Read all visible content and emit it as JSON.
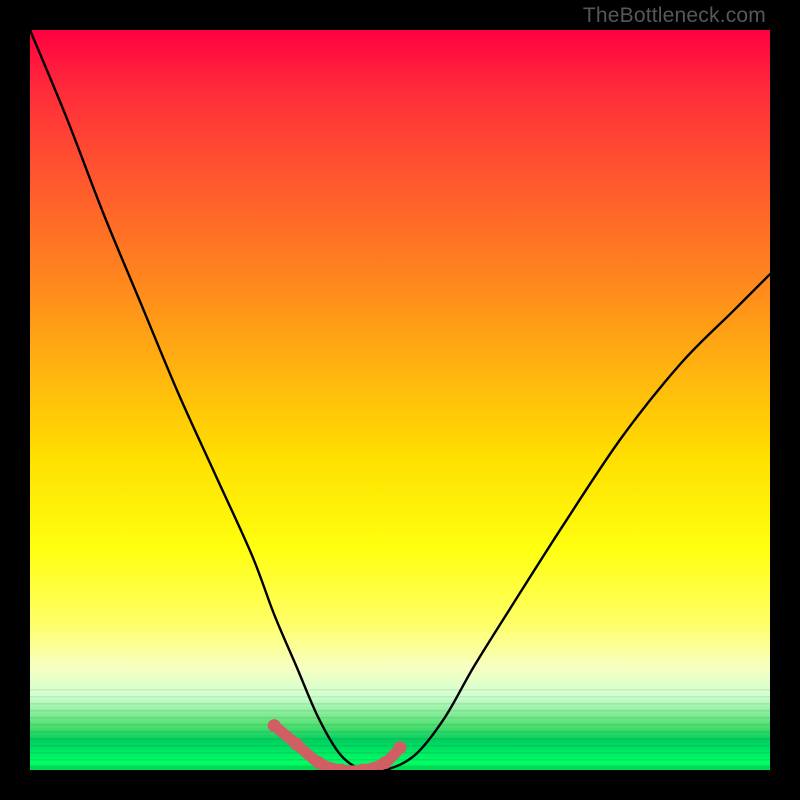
{
  "watermark": "TheBottleneck.com",
  "chart_data": {
    "type": "line",
    "title": "",
    "xlabel": "",
    "ylabel": "",
    "xlim": [
      0,
      100
    ],
    "ylim": [
      0,
      100
    ],
    "grid": false,
    "series": [
      {
        "name": "bottleneck-curve",
        "x": [
          0,
          5,
          10,
          15,
          20,
          25,
          30,
          33,
          36,
          39,
          42,
          45,
          48,
          52,
          56,
          60,
          65,
          72,
          80,
          88,
          95,
          100
        ],
        "values": [
          100,
          88,
          75,
          63,
          51,
          40,
          29,
          21,
          14,
          7,
          2,
          0,
          0,
          2,
          7,
          14,
          22,
          33,
          45,
          55,
          62,
          67
        ]
      }
    ],
    "highlight": {
      "name": "optimal-band",
      "color": "#cf5f62",
      "x": [
        33,
        36,
        39,
        42,
        45,
        48,
        50
      ],
      "values": [
        6,
        3.5,
        1,
        0,
        0,
        1,
        3
      ]
    },
    "background_gradient": {
      "top": "#ff0040",
      "mid": "#ffff10",
      "bottom": "#00d84f"
    }
  }
}
